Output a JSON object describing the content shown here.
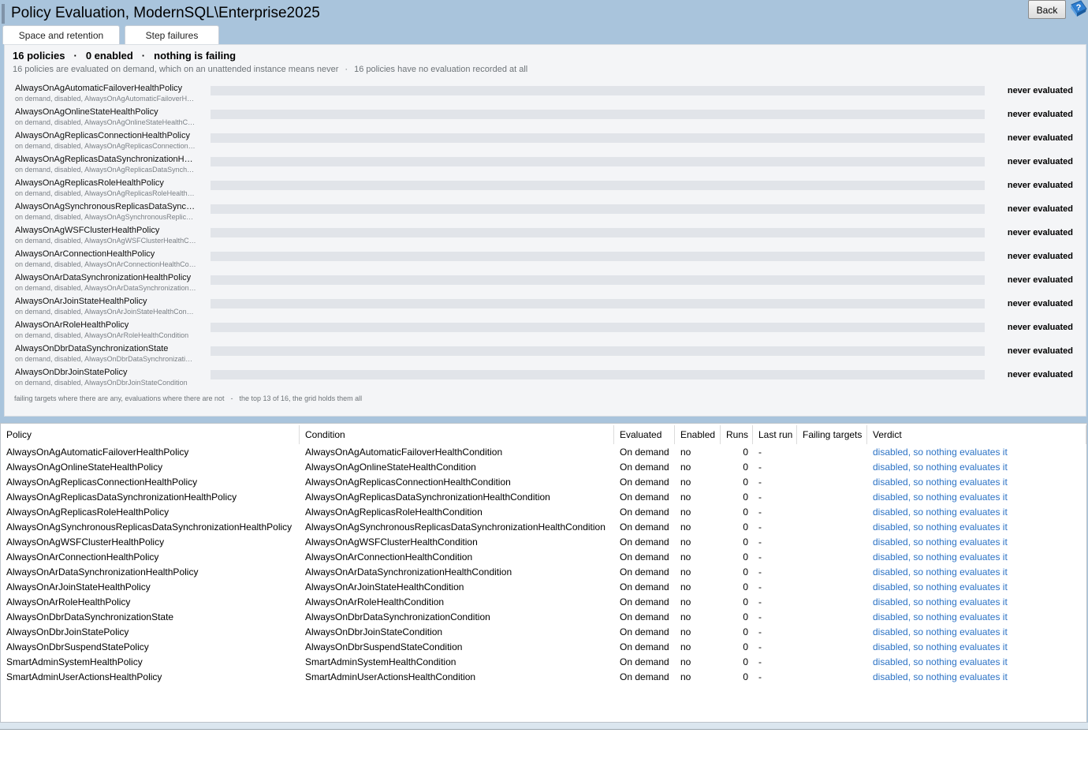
{
  "window": {
    "title": "Policy Evaluation, ModernSQL\\Enterprise2025",
    "back_label": "Back",
    "help_icon": "help-question-icon"
  },
  "tabs": [
    {
      "label": "Space and retention"
    },
    {
      "label": "Step failures"
    }
  ],
  "summary": {
    "policies": "16 policies",
    "separator": "·",
    "enabled": "0 enabled",
    "failing": "nothing is failing",
    "subtext_a": "16 policies are evaluated on demand, which on an unattended instance means never",
    "subtext_dot": "·",
    "subtext_b": "16 policies have no evaluation recorded at all"
  },
  "policy_rows": [
    {
      "name": "AlwaysOnAgAutomaticFailoverHealthPolicy",
      "meta": "on demand, disabled, AlwaysOnAgAutomaticFailoverHealthCondition",
      "status": "never evaluated"
    },
    {
      "name": "AlwaysOnAgOnlineStateHealthPolicy",
      "meta": "on demand, disabled, AlwaysOnAgOnlineStateHealthCondition",
      "status": "never evaluated"
    },
    {
      "name": "AlwaysOnAgReplicasConnectionHealthPolicy",
      "meta": "on demand, disabled, AlwaysOnAgReplicasConnectionHealthCondition",
      "status": "never evaluated"
    },
    {
      "name": "AlwaysOnAgReplicasDataSynchronizationHealthPolicy",
      "meta": "on demand, disabled, AlwaysOnAgReplicasDataSynchronizationHealthCondition",
      "status": "never evaluated"
    },
    {
      "name": "AlwaysOnAgReplicasRoleHealthPolicy",
      "meta": "on demand, disabled, AlwaysOnAgReplicasRoleHealthCondition",
      "status": "never evaluated"
    },
    {
      "name": "AlwaysOnAgSynchronousReplicasDataSynchronizationHealthPolicy",
      "meta": "on demand, disabled, AlwaysOnAgSynchronousReplicasDataSynchronizationHealthCondition",
      "status": "never evaluated"
    },
    {
      "name": "AlwaysOnAgWSFClusterHealthPolicy",
      "meta": "on demand, disabled, AlwaysOnAgWSFClusterHealthCondition",
      "status": "never evaluated"
    },
    {
      "name": "AlwaysOnArConnectionHealthPolicy",
      "meta": "on demand, disabled, AlwaysOnArConnectionHealthCondition",
      "status": "never evaluated"
    },
    {
      "name": "AlwaysOnArDataSynchronizationHealthPolicy",
      "meta": "on demand, disabled, AlwaysOnArDataSynchronizationHealthCondition",
      "status": "never evaluated"
    },
    {
      "name": "AlwaysOnArJoinStateHealthPolicy",
      "meta": "on demand, disabled, AlwaysOnArJoinStateHealthCondition",
      "status": "never evaluated"
    },
    {
      "name": "AlwaysOnArRoleHealthPolicy",
      "meta": "on demand, disabled, AlwaysOnArRoleHealthCondition",
      "status": "never evaluated"
    },
    {
      "name": "AlwaysOnDbrDataSynchronizationState",
      "meta": "on demand, disabled, AlwaysOnDbrDataSynchronizationCondition",
      "status": "never evaluated"
    },
    {
      "name": "AlwaysOnDbrJoinStatePolicy",
      "meta": "on demand, disabled, AlwaysOnDbrJoinStateCondition",
      "status": "never evaluated"
    }
  ],
  "footnote": {
    "a": "failing targets where there are any, evaluations where there are not",
    "dash": "-",
    "b": "the top 13 of 16, the grid holds them all"
  },
  "grid": {
    "headers": [
      "Policy",
      "Condition",
      "Evaluated",
      "Enabled",
      "Runs",
      "Last run",
      "Failing targets",
      "Verdict"
    ],
    "rows": [
      [
        "AlwaysOnAgAutomaticFailoverHealthPolicy",
        "AlwaysOnAgAutomaticFailoverHealthCondition",
        "On demand",
        "no",
        "0",
        "-",
        "",
        "disabled, so nothing evaluates it"
      ],
      [
        "AlwaysOnAgOnlineStateHealthPolicy",
        "AlwaysOnAgOnlineStateHealthCondition",
        "On demand",
        "no",
        "0",
        "-",
        "",
        "disabled, so nothing evaluates it"
      ],
      [
        "AlwaysOnAgReplicasConnectionHealthPolicy",
        "AlwaysOnAgReplicasConnectionHealthCondition",
        "On demand",
        "no",
        "0",
        "-",
        "",
        "disabled, so nothing evaluates it"
      ],
      [
        "AlwaysOnAgReplicasDataSynchronizationHealthPolicy",
        "AlwaysOnAgReplicasDataSynchronizationHealthCondition",
        "On demand",
        "no",
        "0",
        "-",
        "",
        "disabled, so nothing evaluates it"
      ],
      [
        "AlwaysOnAgReplicasRoleHealthPolicy",
        "AlwaysOnAgReplicasRoleHealthCondition",
        "On demand",
        "no",
        "0",
        "-",
        "",
        "disabled, so nothing evaluates it"
      ],
      [
        "AlwaysOnAgSynchronousReplicasDataSynchronizationHealthPolicy",
        "AlwaysOnAgSynchronousReplicasDataSynchronizationHealthCondition",
        "On demand",
        "no",
        "0",
        "-",
        "",
        "disabled, so nothing evaluates it"
      ],
      [
        "AlwaysOnAgWSFClusterHealthPolicy",
        "AlwaysOnAgWSFClusterHealthCondition",
        "On demand",
        "no",
        "0",
        "-",
        "",
        "disabled, so nothing evaluates it"
      ],
      [
        "AlwaysOnArConnectionHealthPolicy",
        "AlwaysOnArConnectionHealthCondition",
        "On demand",
        "no",
        "0",
        "-",
        "",
        "disabled, so nothing evaluates it"
      ],
      [
        "AlwaysOnArDataSynchronizationHealthPolicy",
        "AlwaysOnArDataSynchronizationHealthCondition",
        "On demand",
        "no",
        "0",
        "-",
        "",
        "disabled, so nothing evaluates it"
      ],
      [
        "AlwaysOnArJoinStateHealthPolicy",
        "AlwaysOnArJoinStateHealthCondition",
        "On demand",
        "no",
        "0",
        "-",
        "",
        "disabled, so nothing evaluates it"
      ],
      [
        "AlwaysOnArRoleHealthPolicy",
        "AlwaysOnArRoleHealthCondition",
        "On demand",
        "no",
        "0",
        "-",
        "",
        "disabled, so nothing evaluates it"
      ],
      [
        "AlwaysOnDbrDataSynchronizationState",
        "AlwaysOnDbrDataSynchronizationCondition",
        "On demand",
        "no",
        "0",
        "-",
        "",
        "disabled, so nothing evaluates it"
      ],
      [
        "AlwaysOnDbrJoinStatePolicy",
        "AlwaysOnDbrJoinStateCondition",
        "On demand",
        "no",
        "0",
        "-",
        "",
        "disabled, so nothing evaluates it"
      ],
      [
        "AlwaysOnDbrSuspendStatePolicy",
        "AlwaysOnDbrSuspendStateCondition",
        "On demand",
        "no",
        "0",
        "-",
        "",
        "disabled, so nothing evaluates it"
      ],
      [
        "SmartAdminSystemHealthPolicy",
        "SmartAdminSystemHealthCondition",
        "On demand",
        "no",
        "0",
        "-",
        "",
        "disabled, so nothing evaluates it"
      ],
      [
        "SmartAdminUserActionsHealthPolicy",
        "SmartAdminUserActionsHealthCondition",
        "On demand",
        "no",
        "0",
        "-",
        "",
        "disabled, so nothing evaluates it"
      ]
    ]
  },
  "colors": {
    "frame": "#a9c4dc",
    "link": "#2b72c5",
    "bar_track": "#e1e4e9"
  }
}
